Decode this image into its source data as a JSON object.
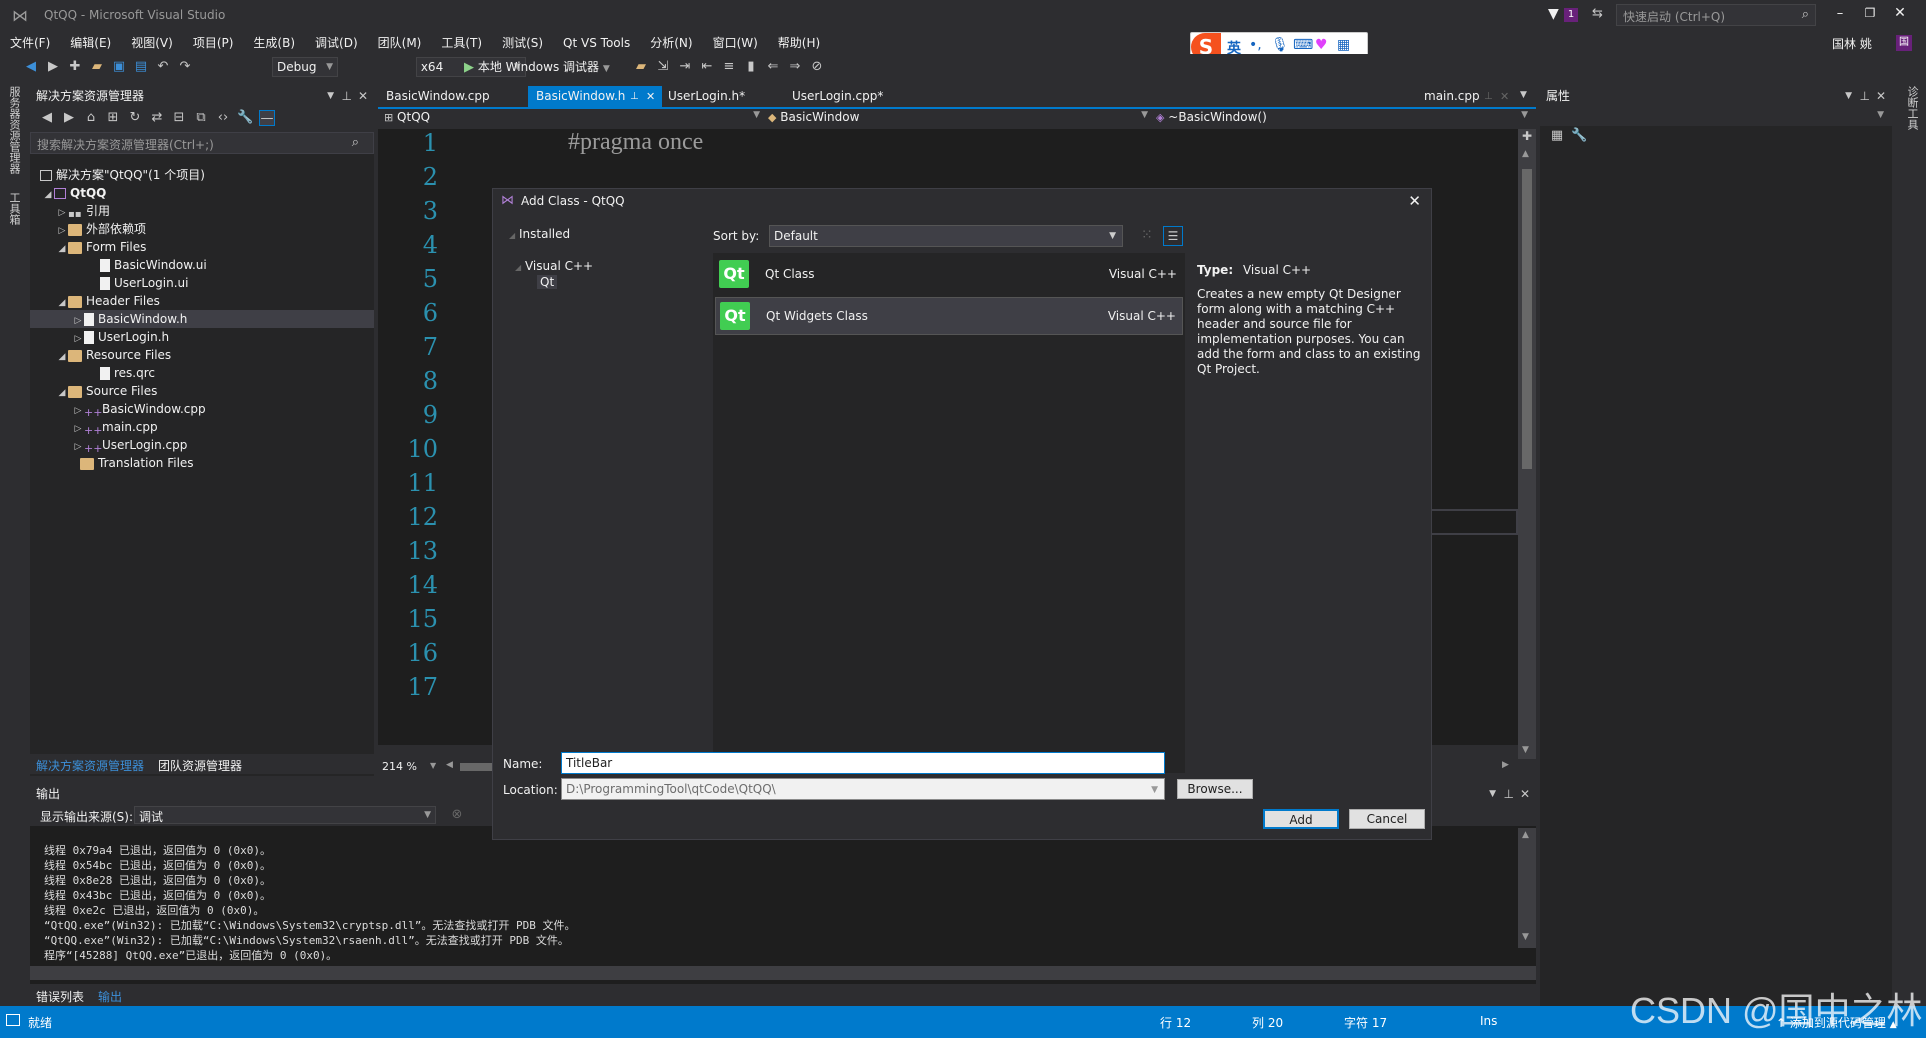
{
  "window": {
    "title": "QtQQ - Microsoft Visual Studio",
    "quick_launch_placeholder": "快速启动 (Ctrl+Q)",
    "user_name": "国林 姚",
    "notification_count": "1"
  },
  "menu": [
    "文件(F)",
    "编辑(E)",
    "视图(V)",
    "项目(P)",
    "生成(B)",
    "调试(D)",
    "团队(M)",
    "工具(T)",
    "测试(S)",
    "Qt VS Tools",
    "分析(N)",
    "窗口(W)",
    "帮助(H)"
  ],
  "toolbar": {
    "config": "Debug",
    "platform": "x64",
    "run_label": "本地 Windows 调试器"
  },
  "ime": {
    "lang": "英"
  },
  "solution_explorer": {
    "title": "解决方案资源管理器",
    "search_placeholder": "搜索解决方案资源管理器(Ctrl+;)",
    "solution": "解决方案\"QtQQ\"(1 个项目)",
    "project": "QtQQ",
    "items": {
      "references": "引用",
      "external": "外部依赖项",
      "form_files": "Form Files",
      "basicwindow_ui": "BasicWindow.ui",
      "userlogin_ui": "UserLogin.ui",
      "header_files": "Header Files",
      "basicwindow_h": "BasicWindow.h",
      "userlogin_h": "UserLogin.h",
      "resource_files": "Resource Files",
      "res_qrc": "res.qrc",
      "source_files": "Source Files",
      "basicwindow_cpp": "BasicWindow.cpp",
      "main_cpp": "main.cpp",
      "userlogin_cpp": "UserLogin.cpp",
      "translation_files": "Translation Files"
    },
    "bottom_tabs": [
      "解决方案资源管理器",
      "团队资源管理器"
    ]
  },
  "side_tabs": {
    "left1": "服务器资源管理器",
    "left2": "工具箱",
    "right": "诊断工具"
  },
  "editor": {
    "tabs": [
      "BasicWindow.cpp",
      "BasicWindow.h",
      "UserLogin.h*",
      "UserLogin.cpp*"
    ],
    "right_tab": "main.cpp",
    "nav_project": "QtQQ",
    "nav_class": "BasicWindow",
    "nav_member": "~BasicWindow()",
    "code_line1": "#pragma once",
    "line_numbers": [
      "1",
      "2",
      "3",
      "4",
      "5",
      "6",
      "7",
      "8",
      "9",
      "10",
      "11",
      "12",
      "13",
      "14",
      "15",
      "16",
      "17"
    ],
    "zoom": "214 %"
  },
  "properties": {
    "title": "属性"
  },
  "output": {
    "title": "输出",
    "source_label": "显示输出来源(S):",
    "source_value": "调试",
    "lines": [
      "线程 0x79a4 已退出，返回值为 0 (0x0)。",
      "线程 0x54bc 已退出，返回值为 0 (0x0)。",
      "线程 0x8e28 已退出，返回值为 0 (0x0)。",
      "线程 0x43bc 已退出，返回值为 0 (0x0)。",
      "线程 0xe2c 已退出，返回值为 0 (0x0)。",
      "“QtQQ.exe”(Win32): 已加载“C:\\Windows\\System32\\cryptsp.dll”。无法查找或打开 PDB 文件。",
      "“QtQQ.exe”(Win32): 已加载“C:\\Windows\\System32\\rsaenh.dll”。无法查找或打开 PDB 文件。",
      "程序“[45288] QtQQ.exe”已退出，返回值为 0 (0x0)。"
    ],
    "bottom_tabs": [
      "错误列表",
      "输出"
    ]
  },
  "dialog": {
    "title": "Add Class - QtQQ",
    "installed": "Installed",
    "tree_vcpp": "Visual C++",
    "tree_qt": "Qt",
    "sort_label": "Sort by:",
    "sort_value": "Default",
    "templates": [
      {
        "name": "Qt Class",
        "lang": "Visual C++",
        "icon": "Qt"
      },
      {
        "name": "Qt Widgets Class",
        "lang": "Visual C++",
        "icon": "Qt"
      }
    ],
    "type_label": "Type:",
    "type_value": "Visual C++",
    "description": "Creates a new empty Qt Designer form along with a matching C++ header and source file for implementation purposes. You can add the form and class to an existing Qt Project.",
    "name_label": "Name:",
    "name_value": "TitleBar",
    "location_label": "Location:",
    "location_value": "D:\\ProgrammingTool\\qtCode\\QtQQ\\",
    "browse": "Browse...",
    "add": "Add",
    "cancel": "Cancel"
  },
  "status": {
    "ready": "就绪",
    "row": "行 12",
    "col": "列 20",
    "char": "字符 17",
    "mode": "Ins",
    "source_control": "添加到源代码管理"
  },
  "watermark": "CSDN @国中之林",
  "colors": {
    "accent": "#007acc",
    "qt_green": "#41cd52",
    "selection": "#3f3f46"
  }
}
